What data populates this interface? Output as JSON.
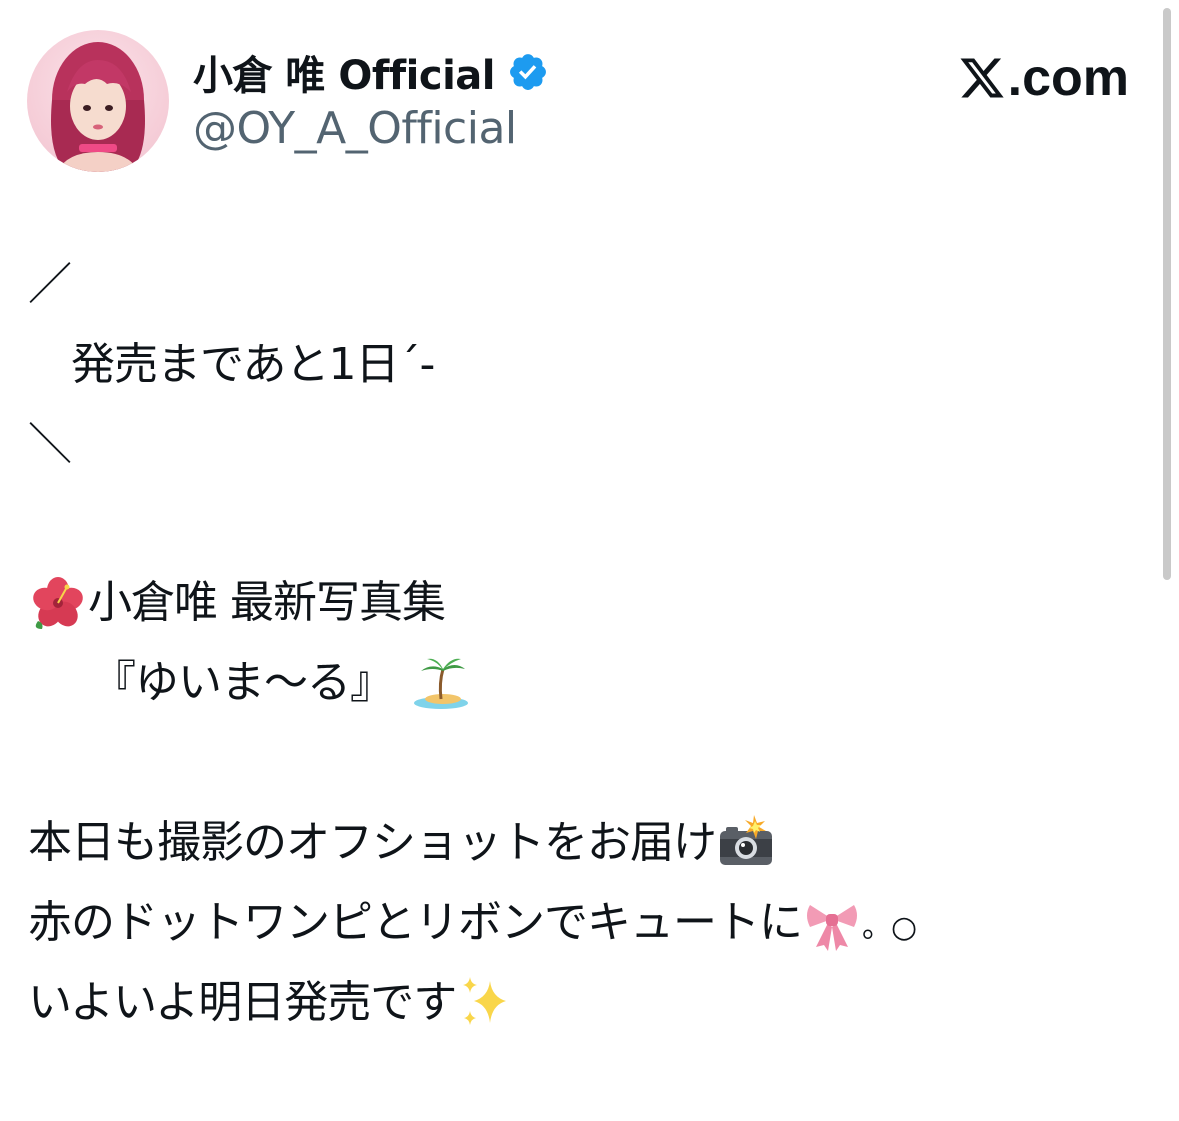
{
  "header": {
    "display_name": "小倉 唯 Official",
    "handle": "@OY_A_Official",
    "brand": ".com",
    "avatar_icon": "profile-avatar",
    "verified_icon": "verified-badge-icon",
    "x_logo_icon": "x-logo-icon"
  },
  "colors": {
    "text": "#0f1419",
    "secondary": "#536471",
    "verified": "#1d9bf0"
  },
  "tweet": {
    "line1": "／",
    "line2": "　発売まであと1日´-",
    "line3": "＼",
    "line4": "小倉唯 最新写真集",
    "line5": "　　『ゆいま〜る』",
    "line6": "本日も撮影のオフショットをお届け",
    "line7": "赤のドットワンピとリボンでキュートに",
    "line7_tail": "。○",
    "line8": "いよいよ明日発売です",
    "emojis": {
      "hibiscus": "hibiscus-emoji",
      "island": "desert-island-emoji",
      "camera": "camera-with-flash-emoji",
      "ribbon": "ribbon-emoji",
      "sparkles": "sparkles-emoji"
    }
  }
}
